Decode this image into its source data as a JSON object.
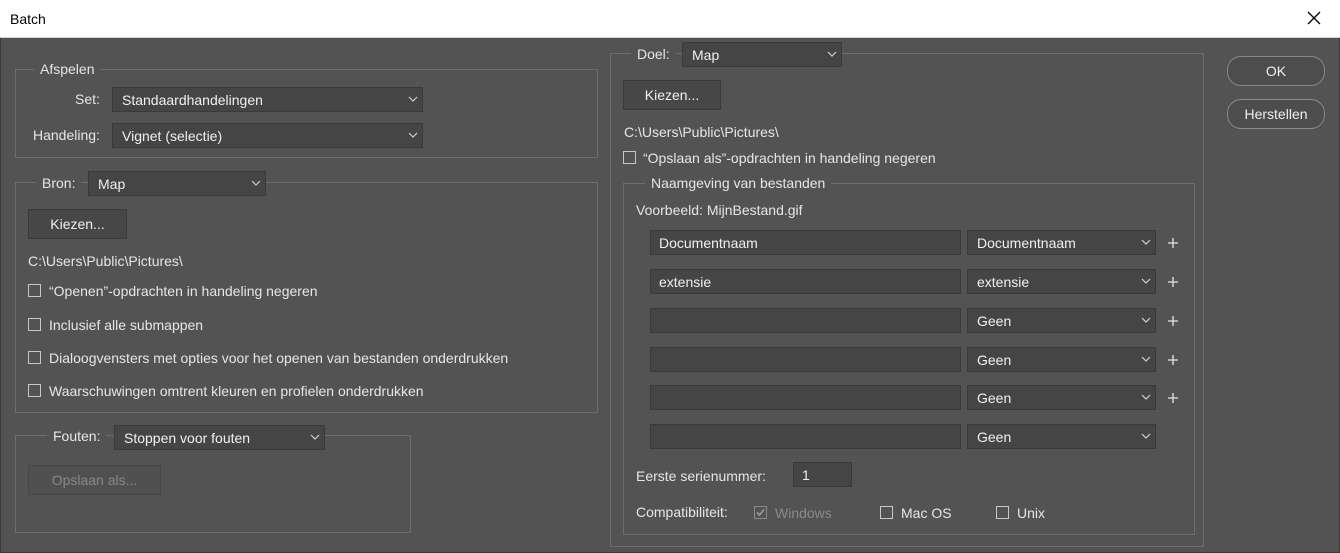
{
  "window": {
    "title": "Batch"
  },
  "buttons": {
    "ok": "OK",
    "reset": "Herstellen"
  },
  "afspelen": {
    "legend": "Afspelen",
    "set_label": "Set:",
    "set_value": "Standaardhandelingen",
    "action_label": "Handeling:",
    "action_value": "Vignet (selectie)"
  },
  "bron": {
    "label": "Bron:",
    "value": "Map",
    "choose_button": "Kiezen...",
    "path": "C:\\Users\\Public\\Pictures\\",
    "checkboxes": [
      {
        "label": "“Openen”-opdrachten in handeling negeren",
        "checked": false
      },
      {
        "label": "Inclusief alle submappen",
        "checked": false
      },
      {
        "label": "Dialoogvensters met opties voor het openen van bestanden onderdrukken",
        "checked": false
      },
      {
        "label": "Waarschuwingen omtrent kleuren en profielen onderdrukken",
        "checked": false
      }
    ]
  },
  "fouten": {
    "label": "Fouten:",
    "value": "Stoppen voor fouten",
    "save_button": "Opslaan als..."
  },
  "doel": {
    "label": "Doel:",
    "value": "Map",
    "choose_button": "Kiezen...",
    "path": "C:\\Users\\Public\\Pictures\\",
    "override_save_label": "“Opslaan als”-opdrachten in handeling negeren",
    "override_save_checked": false
  },
  "naamgeving": {
    "legend": "Naamgeving van bestanden",
    "example": "Voorbeeld: MijnBestand.gif",
    "rows": [
      {
        "text": "Documentnaam",
        "select": "Documentnaam"
      },
      {
        "text": "extensie",
        "select": "extensie"
      },
      {
        "text": "",
        "select": "Geen"
      },
      {
        "text": "",
        "select": "Geen"
      },
      {
        "text": "",
        "select": "Geen"
      },
      {
        "text": "",
        "select": "Geen"
      }
    ],
    "serial_label": "Eerste serienummer:",
    "serial_value": "1",
    "compat_label": "Compatibiliteit:",
    "compat": [
      {
        "label": "Windows",
        "checked": true,
        "enabled": false
      },
      {
        "label": "Mac OS",
        "checked": false,
        "enabled": true
      },
      {
        "label": "Unix",
        "checked": false,
        "enabled": true
      }
    ]
  },
  "icons": {
    "close": "close-icon",
    "chevron": "chevron-down-icon",
    "plus": "plus-icon",
    "check": "checkmark-icon"
  }
}
